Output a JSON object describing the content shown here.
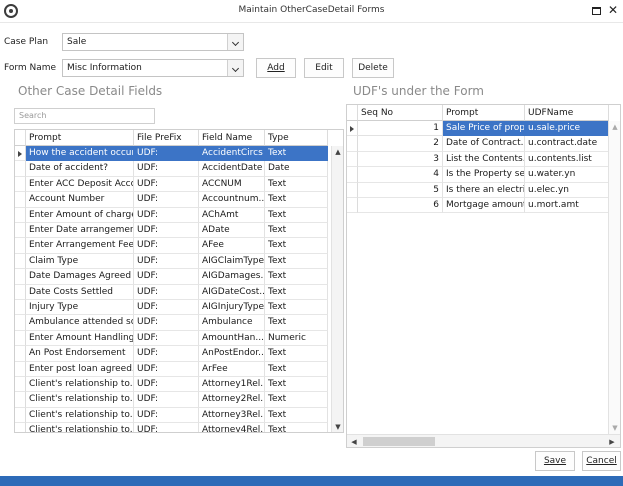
{
  "window": {
    "title": "Maintain OtherCaseDetail Forms"
  },
  "top": {
    "case_plan_label": "Case Plan",
    "case_plan_value": "Sale",
    "form_name_label": "Form Name",
    "form_name_value": "Misc Information",
    "add_label": "Add",
    "edit_label": "Edit",
    "delete_label": "Delete"
  },
  "left": {
    "title": "Other Case Detail Fields",
    "search_placeholder": "Search",
    "headers": [
      "Prompt",
      "File PreFix",
      "Field Name",
      "Type"
    ],
    "rows": [
      [
        "How the accident occur...",
        "UDF:",
        "AccidentCircs",
        "Text"
      ],
      [
        "Date of accident?",
        "UDF:",
        "AccidentDate",
        "Date"
      ],
      [
        "Enter ACC Deposit Acco...",
        "UDF:",
        "ACCNUM",
        "Text"
      ],
      [
        "Account Number",
        "UDF:",
        "Accountnum...",
        "Text"
      ],
      [
        "Enter Amount of charge...",
        "UDF:",
        "AChAmt",
        "Text"
      ],
      [
        "Enter Date arrangemen...",
        "UDF:",
        "ADate",
        "Text"
      ],
      [
        "Enter Arrangement Fee",
        "UDF:",
        "AFee",
        "Text"
      ],
      [
        "Claim Type",
        "UDF:",
        "AIGClaimType",
        "Text"
      ],
      [
        "Date Damages Agreed",
        "UDF:",
        "AIGDamages...",
        "Text"
      ],
      [
        "Date Costs Settled",
        "UDF:",
        "AIGDateCost...",
        "Text"
      ],
      [
        "Injury Type",
        "UDF:",
        "AIGInjuryType",
        "Text"
      ],
      [
        "Ambulance attended sc...",
        "UDF:",
        "Ambulance",
        "Text"
      ],
      [
        "Enter Amount Handling...",
        "UDF:",
        "AmountHan...",
        "Numeric"
      ],
      [
        "An Post Endorsement",
        "UDF:",
        "AnPostEndor...",
        "Text"
      ],
      [
        "Enter post loan agreed...",
        "UDF:",
        "ArFee",
        "Text"
      ],
      [
        "Client's relationship to...",
        "UDF:",
        "Attorney1Rel...",
        "Text"
      ],
      [
        "Client's relationship to...",
        "UDF:",
        "Attorney2Rel...",
        "Text"
      ],
      [
        "Client's relationship to...",
        "UDF:",
        "Attorney3Rel...",
        "Text"
      ],
      [
        "Client's relationship to...",
        "UDF:",
        "Attorney4Rel...",
        "Text"
      ]
    ]
  },
  "right": {
    "title": "UDF's under the Form",
    "headers": [
      "Seq No",
      "Prompt",
      "UDFName"
    ],
    "rows": [
      [
        "1",
        "Sale Price of prop...",
        "u.sale.price"
      ],
      [
        "2",
        "Date of Contract...",
        "u.contract.date"
      ],
      [
        "3",
        "List the Contents...",
        "u.contents.list"
      ],
      [
        "4",
        "Is the Property se...",
        "u.water.yn"
      ],
      [
        "5",
        "Is there an electri...",
        "u.elec.yn"
      ],
      [
        "6",
        "Mortgage amount?",
        "u.mort.amt"
      ]
    ]
  },
  "bottom": {
    "save_label": "Save",
    "cancel_label": "Cancel"
  },
  "colors": {
    "selection": "#3c74c6",
    "statusbar": "#2d6bb8"
  }
}
